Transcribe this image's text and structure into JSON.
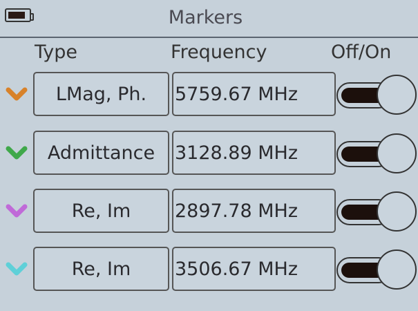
{
  "header": {
    "title": "Markers",
    "battery_icon": "battery-icon"
  },
  "columns": {
    "type": "Type",
    "frequency": "Frequency",
    "toggle": "Off/On"
  },
  "markers": [
    {
      "type": "LMag, Ph.",
      "frequency": "5759.67 MHz",
      "color": "#d8822a",
      "on": true
    },
    {
      "type": "Admittance",
      "frequency": "3128.89 MHz",
      "color": "#3fa84a",
      "on": true
    },
    {
      "type": "Re, Im",
      "frequency": "2897.78 MHz",
      "color": "#c06ad8",
      "on": true
    },
    {
      "type": "Re, Im",
      "frequency": "3506.67 MHz",
      "color": "#5fd0d8",
      "on": true
    }
  ]
}
